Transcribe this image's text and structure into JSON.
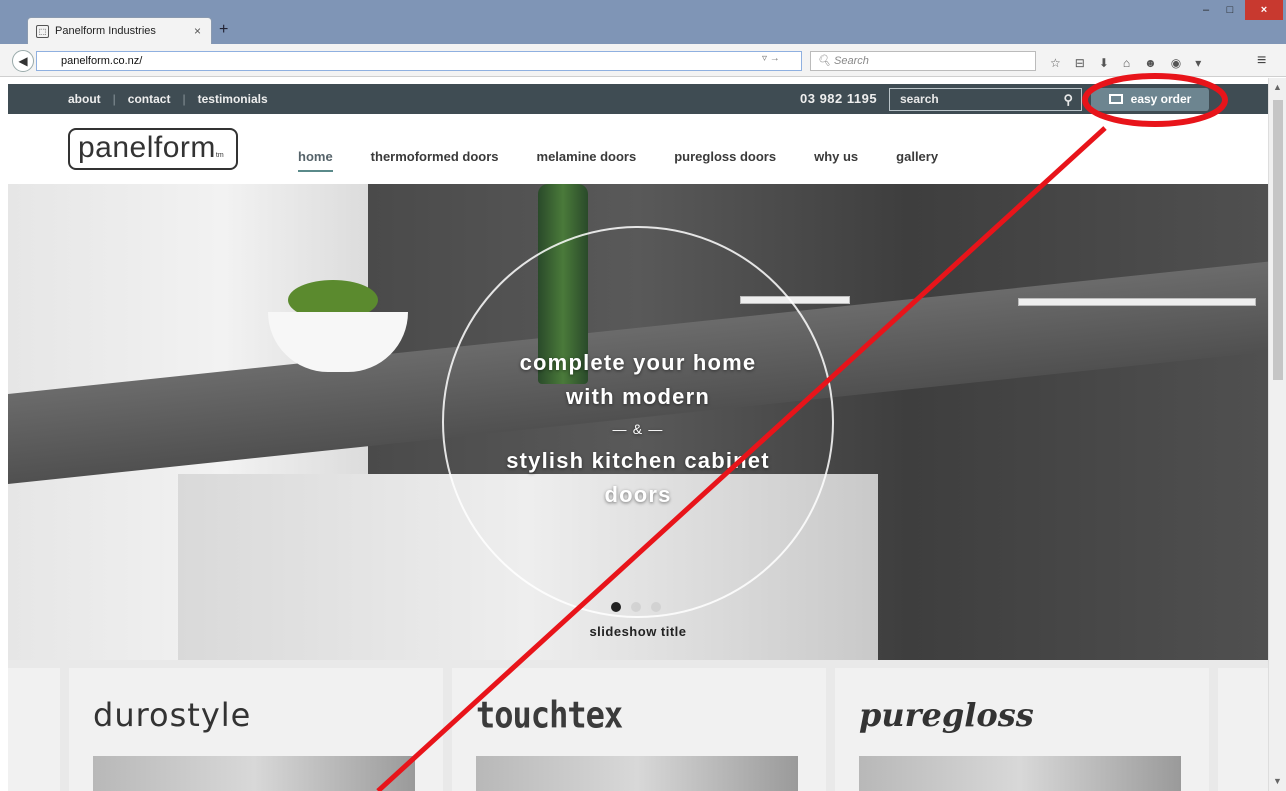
{
  "browser": {
    "tab_title": "Panelform Industries",
    "tab_close": "×",
    "new_tab": "+",
    "url": "panelform.co.nz/",
    "search_placeholder": "Search",
    "window_min": "–",
    "window_max": "□",
    "window_close": "×"
  },
  "site": {
    "toplinks": [
      "about",
      "contact",
      "testimonials"
    ],
    "separator": "|",
    "phone": "03 982 1195",
    "search_placeholder": "search",
    "easy_order": "easy order",
    "logo": "panelform",
    "logo_tm": "tm",
    "nav": [
      "home",
      "thermoformed doors",
      "melamine doors",
      "puregloss doors",
      "why us",
      "gallery"
    ],
    "hero": {
      "line1": "complete your home",
      "line2": "with modern",
      "amp": "— & —",
      "line3": "stylish kitchen cabinet",
      "line4": "doors",
      "slide_title": "slideshow title"
    },
    "products": [
      "durostyle",
      "touchtex",
      "puregloss"
    ]
  },
  "colors": {
    "topbar": "#3f4c53",
    "easy_order_bg": "#6d8590",
    "annotation": "#e8141a"
  }
}
